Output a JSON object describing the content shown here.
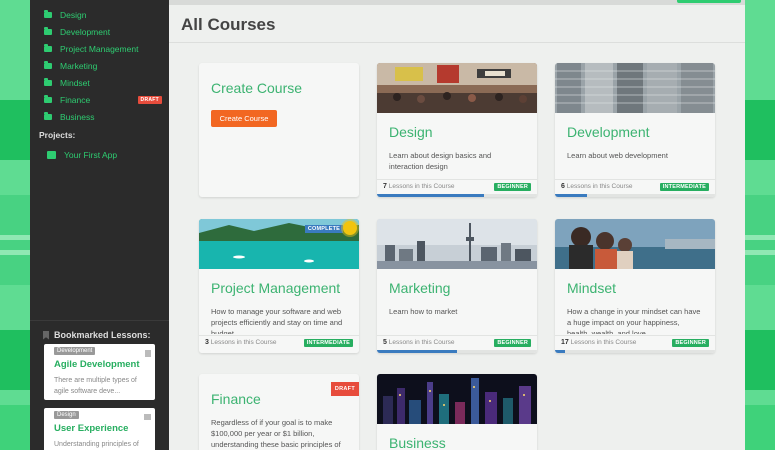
{
  "sidebar": {
    "categories": [
      {
        "label": "Design",
        "draft": ""
      },
      {
        "label": "Development",
        "draft": ""
      },
      {
        "label": "Project Management",
        "draft": ""
      },
      {
        "label": "Marketing",
        "draft": ""
      },
      {
        "label": "Mindset",
        "draft": ""
      },
      {
        "label": "Finance",
        "draft": "DRAFT"
      },
      {
        "label": "Business",
        "draft": ""
      }
    ],
    "projects_label": "Projects:",
    "projects": [
      {
        "label": "Your First App"
      }
    ],
    "bookmarks_label": "Bookmarked Lessons:",
    "bookmarks": [
      {
        "category": "Development",
        "title": "Agile Development",
        "desc": "There are multiple types of agile software deve..."
      },
      {
        "category": "Design",
        "title": "User Experience",
        "desc": "Understanding principles of"
      }
    ]
  },
  "main": {
    "title": "All Courses",
    "create": {
      "title": "Create Course",
      "button": "Create Course"
    },
    "courses": [
      {
        "title": "Design",
        "desc": "Learn about design basics and interaction design",
        "lessons": "7",
        "lessons_label": "Lessons in this Course",
        "level": "BEGINNER",
        "progress": 0.67
      },
      {
        "title": "Development",
        "desc": "Learn about web development",
        "lessons": "6",
        "lessons_label": "Lessons in this Course",
        "level": "INTERMEDIATE",
        "progress": 0.2
      },
      {
        "title": "Project Management",
        "desc": "How to manage your software and web projects efficiently and stay on time and budget",
        "lessons": "3",
        "lessons_label": "Lessons in this Course",
        "level": "INTERMEDIATE",
        "progress": 0,
        "badge": "COMPLETE"
      },
      {
        "title": "Marketing",
        "desc": "Learn how to market",
        "lessons": "5",
        "lessons_label": "Lessons in this Course",
        "level": "BEGINNER",
        "progress": 0.5
      },
      {
        "title": "Mindset",
        "desc": "How a change in your mindset can have a huge impact on your happiness, health, wealth, and love",
        "lessons": "17",
        "lessons_label": "Lessons in this Course",
        "level": "BEGINNER",
        "progress": 0.06
      },
      {
        "title": "Finance",
        "desc": "Regardless of if your goal is to make $100,000 per year or $1 billion, understanding these basic principles of",
        "draft": "DRAFT"
      },
      {
        "title": "Business",
        "desc": ""
      }
    ]
  },
  "colors": {
    "accent": "#2ecc71",
    "title_green": "#3cb371",
    "cta": "#f26722",
    "progress": "#3a7bbf",
    "draft": "#e74c3c"
  }
}
